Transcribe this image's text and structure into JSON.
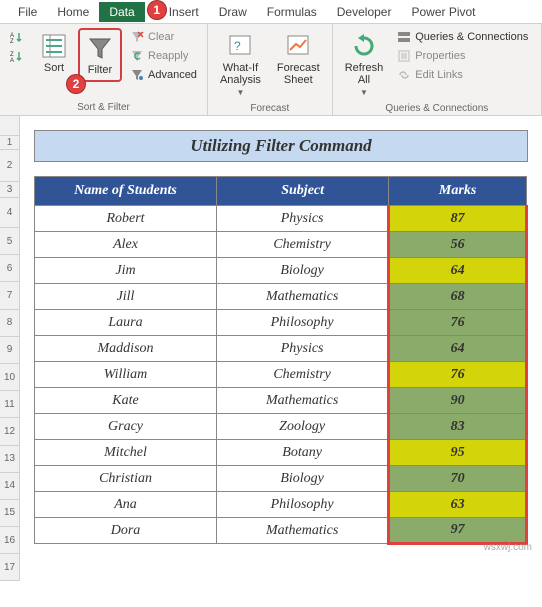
{
  "menubar": {
    "items": [
      "File",
      "Home",
      "Data",
      "Insert",
      "Draw",
      "Formulas",
      "Developer",
      "Power Pivot"
    ],
    "active_index": 2
  },
  "callouts": {
    "one": "1",
    "two": "2"
  },
  "ribbon": {
    "sort_filter": {
      "sort": "Sort",
      "filter": "Filter",
      "clear": "Clear",
      "reapply": "Reapply",
      "advanced": "Advanced",
      "group_label": "Sort & Filter"
    },
    "forecast": {
      "whatif": "What-If\nAnalysis",
      "forecast_sheet": "Forecast\nSheet",
      "group_label": "Forecast"
    },
    "queries": {
      "refresh": "Refresh\nAll",
      "queries_conn": "Queries & Connections",
      "properties": "Properties",
      "edit_links": "Edit Links",
      "group_label": "Queries & Connections"
    }
  },
  "sheet": {
    "title": "Utilizing Filter Command",
    "headers": {
      "name": "Name of Students",
      "subject": "Subject",
      "marks": "Marks"
    },
    "rows": [
      {
        "name": "Robert",
        "subject": "Physics",
        "marks": "87",
        "color": "yellow"
      },
      {
        "name": "Alex",
        "subject": "Chemistry",
        "marks": "56",
        "color": "green"
      },
      {
        "name": "Jim",
        "subject": "Biology",
        "marks": "64",
        "color": "yellow"
      },
      {
        "name": "Jill",
        "subject": "Mathematics",
        "marks": "68",
        "color": "green"
      },
      {
        "name": "Laura",
        "subject": "Philosophy",
        "marks": "76",
        "color": "green"
      },
      {
        "name": "Maddison",
        "subject": "Physics",
        "marks": "64",
        "color": "green"
      },
      {
        "name": "William",
        "subject": "Chemistry",
        "marks": "76",
        "color": "yellow"
      },
      {
        "name": "Kate",
        "subject": "Mathematics",
        "marks": "90",
        "color": "green"
      },
      {
        "name": "Gracy",
        "subject": "Zoology",
        "marks": "83",
        "color": "green"
      },
      {
        "name": "Mitchel",
        "subject": "Botany",
        "marks": "95",
        "color": "yellow"
      },
      {
        "name": "Christian",
        "subject": "Biology",
        "marks": "70",
        "color": "green"
      },
      {
        "name": "Ana",
        "subject": "Philosophy",
        "marks": "63",
        "color": "yellow"
      },
      {
        "name": "Dora",
        "subject": "Mathematics",
        "marks": "97",
        "color": "green"
      }
    ],
    "row_numbers": [
      "1",
      "2",
      "3",
      "4",
      "5",
      "6",
      "7",
      "8",
      "9",
      "10",
      "11",
      "12",
      "13",
      "14",
      "15",
      "16",
      "17"
    ]
  },
  "watermark": "wsxwj.com"
}
